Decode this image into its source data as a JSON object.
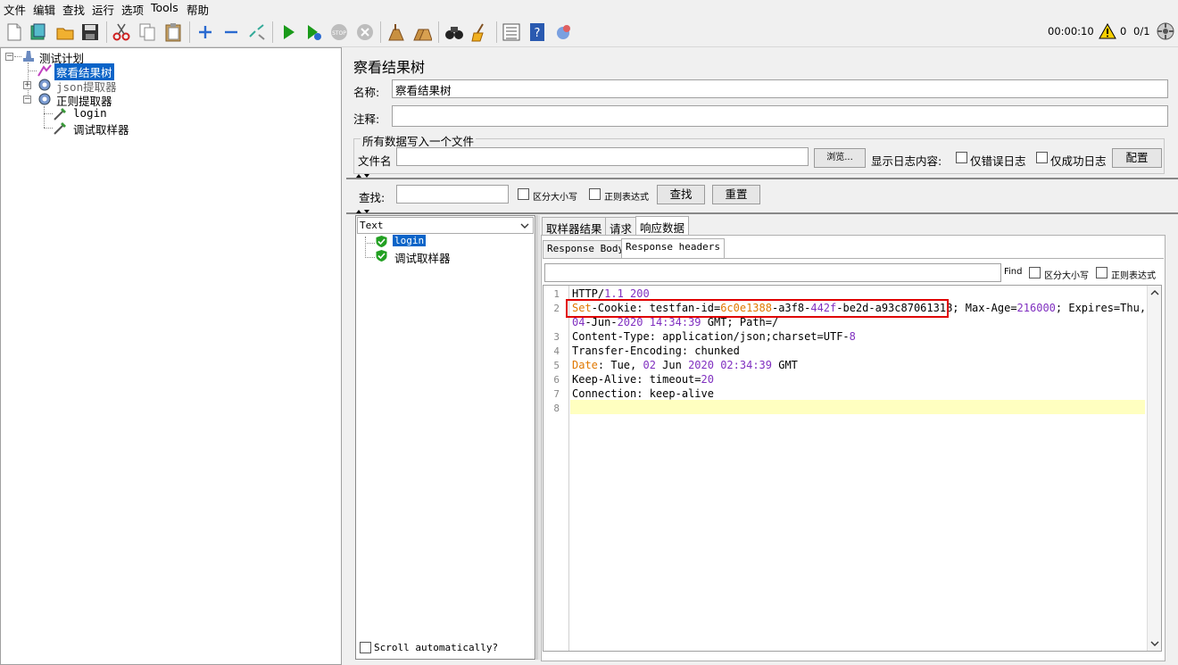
{
  "menu": [
    "文件",
    "编辑",
    "查找",
    "运行",
    "选项",
    "Tools",
    "帮助"
  ],
  "status": {
    "timer": "00:00:10",
    "warnings": "0",
    "threads": "0/1"
  },
  "tree": {
    "root": "测试计划",
    "items": [
      {
        "label": "察看结果树"
      },
      {
        "label": "json提取器"
      },
      {
        "label": "正则提取器"
      },
      {
        "label": "login"
      },
      {
        "label": "调试取样器"
      }
    ]
  },
  "panel": {
    "title": "察看结果树",
    "name_label": "名称:",
    "name_value": "察看结果树",
    "comment_label": "注释:",
    "comment_value": "",
    "file_group_title": "所有数据写入一个文件",
    "filename_label": "文件名",
    "filename_value": "",
    "browse_button": "浏览...",
    "log_label": "显示日志内容:",
    "errors_only": "仅错误日志",
    "success_only": "仅成功日志",
    "configure_button": "配置"
  },
  "search": {
    "label": "查找:",
    "value": "",
    "case_sensitive": "区分大小写",
    "regex": "正则表达式",
    "find_button": "查找",
    "reset_button": "重置"
  },
  "renderer": {
    "selected": "Text"
  },
  "results": [
    {
      "label": "login"
    },
    {
      "label": "调试取样器"
    }
  ],
  "scroll_auto": "Scroll automatically?",
  "tabs": [
    "取样器结果",
    "请求",
    "响应数据"
  ],
  "subtabs": [
    "Response Body",
    "Response headers"
  ],
  "find": {
    "label": "Find",
    "case_sensitive": "区分大小写",
    "regex": "正则表达式",
    "value": ""
  },
  "response_lines": [
    {
      "n": "1",
      "text": "HTTP/1.1 200"
    },
    {
      "n": "2",
      "text": "Set-Cookie: testfan-id=6c0e1388-a3f8-442f-be2d-a93c87061318; Max-Age=216000; Expires=Thu,"
    },
    {
      "n": "",
      "text": "04-Jun-2020 14:34:39 GMT; Path=/"
    },
    {
      "n": "3",
      "text": "Content-Type: application/json;charset=UTF-8"
    },
    {
      "n": "4",
      "text": "Transfer-Encoding: chunked"
    },
    {
      "n": "5",
      "text": "Date: Tue, 02 Jun 2020 02:34:39 GMT"
    },
    {
      "n": "6",
      "text": "Keep-Alive: timeout=20"
    },
    {
      "n": "7",
      "text": "Connection: keep-alive"
    },
    {
      "n": "8",
      "text": ""
    }
  ],
  "colors": {
    "selection": "#0a64c8",
    "highlight_box": "#e00000",
    "current_line": "#ffffc0",
    "number": "#8030c0",
    "key": "#e07800"
  }
}
